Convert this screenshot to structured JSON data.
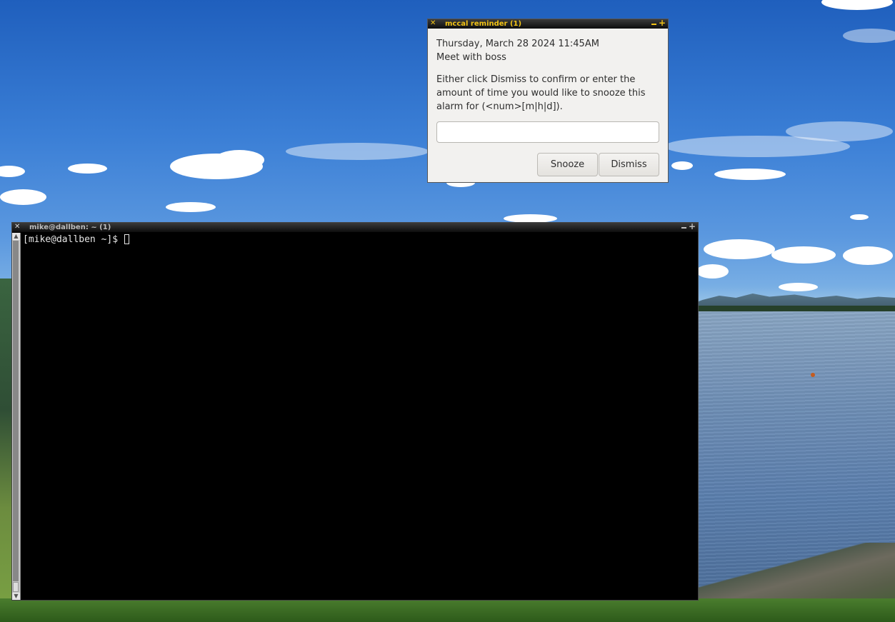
{
  "reminder_window": {
    "title": "mccal reminder (1)",
    "datetime": "Thursday, March 28 2024 11:45AM",
    "event": "Meet with boss",
    "message": "Either click Dismiss to confirm or enter the amount of time you would like to snooze this alarm for (<num>[m|h|d]).",
    "snooze_value": "",
    "buttons": {
      "snooze": "Snooze",
      "dismiss": "Dismiss"
    },
    "title_color": "#f2c316"
  },
  "terminal_window": {
    "title": "mike@dallben: ~ (1)",
    "prompt": "[mike@dallben ~]$ "
  }
}
